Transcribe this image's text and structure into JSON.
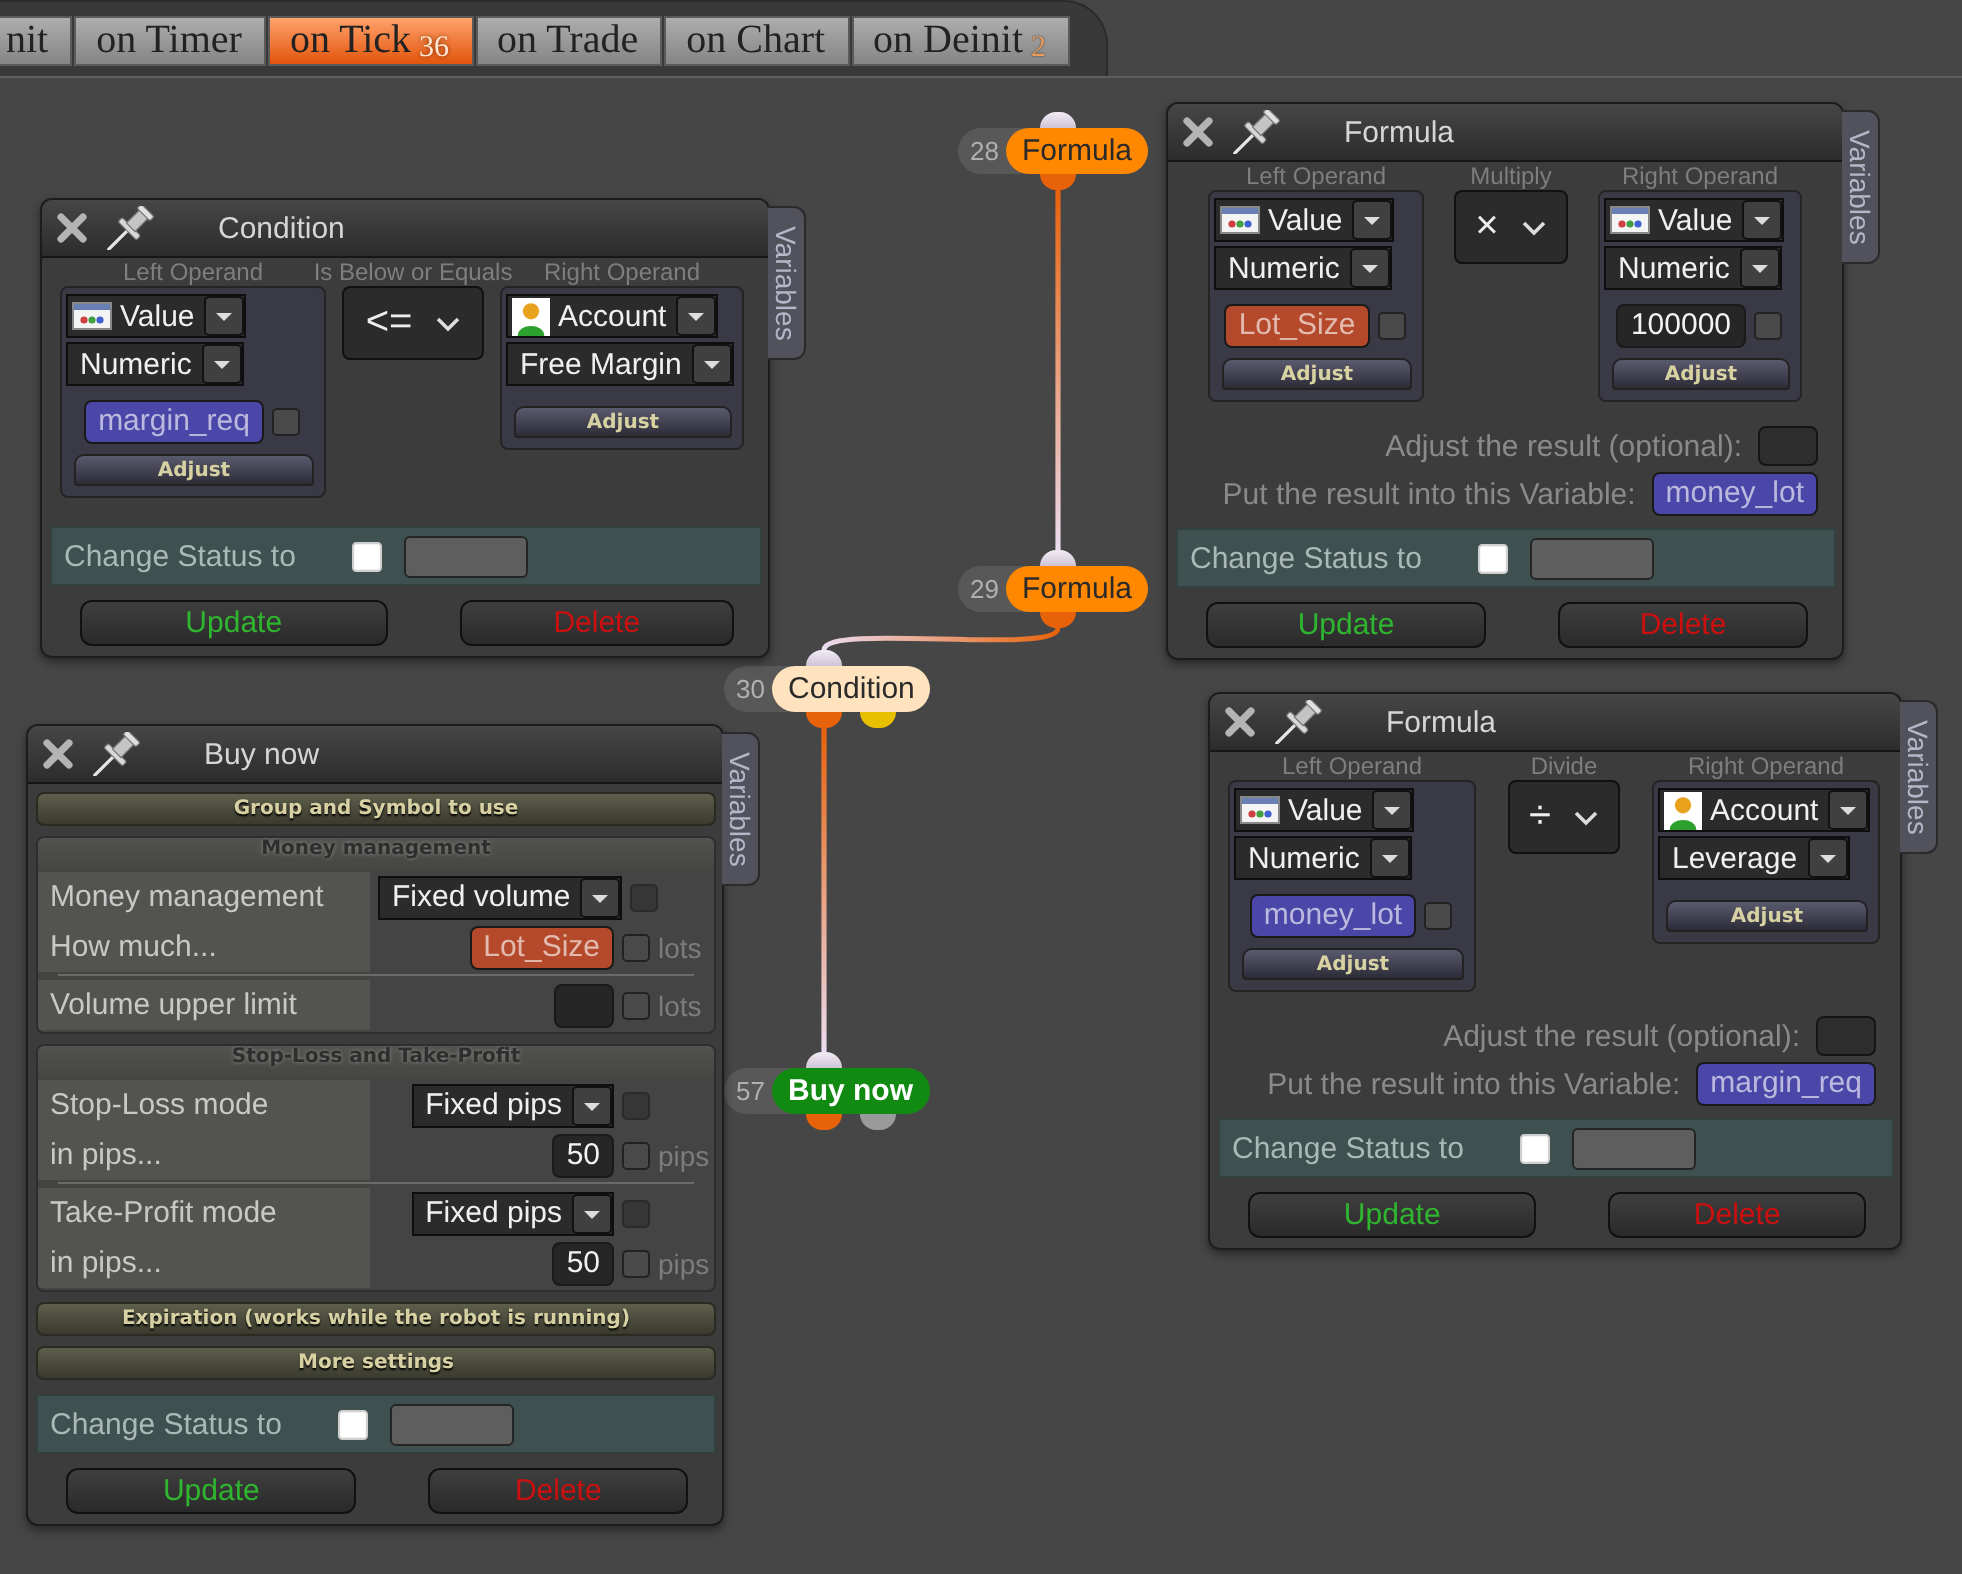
{
  "tabs": [
    {
      "label": "nit",
      "selected": false
    },
    {
      "label": "on Timer",
      "selected": false
    },
    {
      "label": "on Tick",
      "count": "36",
      "selected": true
    },
    {
      "label": "on Trade",
      "selected": false
    },
    {
      "label": "on Chart",
      "selected": false
    },
    {
      "label": "on Deinit",
      "count": "2",
      "selected": false
    }
  ],
  "nodes": [
    {
      "number": "28",
      "label": "Formula",
      "color": "#ff8800",
      "outputs": [
        {
          "color": "#e8620a"
        }
      ],
      "connects_to_next": true
    },
    {
      "number": "29",
      "label": "Formula",
      "color": "#ff8800",
      "outputs": [
        {
          "color": "#e8620a"
        }
      ],
      "connects_to_next": true
    },
    {
      "number": "30",
      "label": "Condition",
      "color": "#ffe3bf",
      "outputs": [
        {
          "color": "#e8620a"
        },
        {
          "color": "#e8c000"
        }
      ],
      "connects_to_next": true
    },
    {
      "number": "57",
      "label": "Buy now",
      "color": "#108a10",
      "outputs": [
        {
          "color": "#e8620a"
        },
        {
          "color": "#9a9a9a"
        }
      ],
      "connects_to_next": false
    }
  ],
  "panels": [
    {
      "kind": "condition",
      "title": "Condition",
      "side_tab": "Variables",
      "left": {
        "heading": "Left Operand",
        "source": {
          "kind": "value",
          "label": "Value"
        },
        "type": "Numeric",
        "input": {
          "value": "margin_req",
          "color": "#4b47a9",
          "checked": false
        },
        "adjust": "Adjust"
      },
      "operator": {
        "heading": "Is Below or Equals",
        "symbol": "<="
      },
      "right": {
        "heading": "Right Operand",
        "source": {
          "kind": "account",
          "label": "Account"
        },
        "type": "Free Margin",
        "adjust": "Adjust"
      },
      "change_status": {
        "label": "Change Status to",
        "checked": false
      },
      "buttons": [
        {
          "label": "Update",
          "color": "#2fb52f"
        },
        {
          "label": "Delete",
          "color": "#cc1010"
        }
      ]
    },
    {
      "kind": "formula",
      "title": "Formula",
      "side_tab": "Variables",
      "left": {
        "heading": "Left Operand",
        "source": {
          "kind": "value",
          "label": "Value"
        },
        "type": "Numeric",
        "input": {
          "value": "Lot_Size",
          "color": "#b5492b",
          "checked": false
        },
        "adjust": "Adjust"
      },
      "operator": {
        "heading": "Multiply",
        "symbol": "×"
      },
      "right": {
        "heading": "Right Operand",
        "source": {
          "kind": "value",
          "label": "Value"
        },
        "type": "Numeric",
        "input": {
          "value": "100000",
          "checked": false
        },
        "adjust": "Adjust"
      },
      "adjust_result": {
        "label": "Adjust the result (optional):"
      },
      "result": {
        "label": "Put the result into this Variable:",
        "value": "money_lot",
        "color": "#4b47a9"
      },
      "change_status": {
        "label": "Change Status to",
        "checked": false
      },
      "buttons": [
        {
          "label": "Update",
          "color": "#2fb52f"
        },
        {
          "label": "Delete",
          "color": "#cc1010"
        }
      ]
    },
    {
      "kind": "order",
      "title": "Buy now",
      "side_tab": "Variables",
      "sections": [
        {
          "title": "Group and Symbol to use",
          "expanded": false
        },
        {
          "title": "Money management",
          "expanded": true,
          "groups": [
            [
              {
                "kind": "select",
                "label": "Money management",
                "value": "Fixed volume",
                "checked": false
              },
              {
                "kind": "variable",
                "label": "How much...",
                "value": "Lot_Size",
                "color": "#b5492b",
                "checked": false,
                "unit": "lots"
              }
            ],
            [
              {
                "kind": "number",
                "label": "Volume upper limit",
                "checked": false,
                "unit": "lots"
              }
            ]
          ]
        },
        {
          "title": "Stop-Loss and Take-Profit",
          "expanded": true,
          "groups": [
            [
              {
                "kind": "select",
                "label": "Stop-Loss mode",
                "value": "Fixed pips",
                "checked": false
              },
              {
                "kind": "number",
                "label": "in pips...",
                "value": "50",
                "checked": false,
                "unit": "pips"
              }
            ],
            [
              {
                "kind": "select",
                "label": "Take-Profit mode",
                "value": "Fixed pips",
                "checked": false
              },
              {
                "kind": "number",
                "label": "in pips...",
                "value": "50",
                "checked": false,
                "unit": "pips"
              }
            ]
          ]
        },
        {
          "title": "Expiration (works while the robot is running)",
          "expanded": false
        },
        {
          "title": "More settings",
          "expanded": false
        }
      ],
      "change_status": {
        "label": "Change Status to",
        "checked": false
      },
      "buttons": [
        {
          "label": "Update",
          "color": "#2fb52f"
        },
        {
          "label": "Delete",
          "color": "#cc1010"
        }
      ]
    },
    {
      "kind": "formula",
      "title": "Formula",
      "side_tab": "Variables",
      "left": {
        "heading": "Left Operand",
        "source": {
          "kind": "value",
          "label": "Value"
        },
        "type": "Numeric",
        "input": {
          "value": "money_lot",
          "color": "#4b47a9",
          "checked": false
        },
        "adjust": "Adjust"
      },
      "operator": {
        "heading": "Divide",
        "symbol": "÷"
      },
      "right": {
        "heading": "Right Operand",
        "source": {
          "kind": "account",
          "label": "Account"
        },
        "type": "Leverage",
        "adjust": "Adjust"
      },
      "adjust_result": {
        "label": "Adjust the result (optional):"
      },
      "result": {
        "label": "Put the result into this Variable:",
        "value": "margin_req",
        "color": "#4b47a9"
      },
      "change_status": {
        "label": "Change Status to",
        "checked": false
      },
      "buttons": [
        {
          "label": "Update",
          "color": "#2fb52f"
        },
        {
          "label": "Delete",
          "color": "#cc1010"
        }
      ]
    }
  ]
}
